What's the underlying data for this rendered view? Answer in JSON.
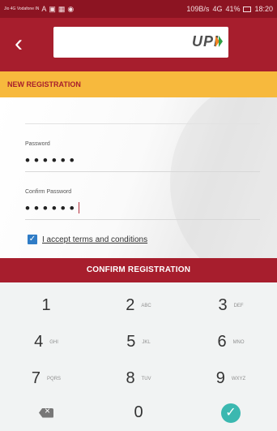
{
  "status_bar": {
    "carrier": "Jio 4G\nVodafone IN",
    "left_icons": [
      "A",
      "▣",
      "▦",
      "◉"
    ],
    "network_speed": "109B/s",
    "signal_text": "4G",
    "battery": "41%",
    "time": "18:20"
  },
  "app_bar": {
    "back_icon": "‹",
    "logo_text": "UPI"
  },
  "section": {
    "title": "NEW REGISTRATION"
  },
  "form": {
    "password_label": "Password",
    "password_value": "••••••",
    "confirm_label": "Confirm Password",
    "confirm_value": "••••••"
  },
  "terms": {
    "check_icon": "✓",
    "text": "I accept terms and conditions"
  },
  "confirm_button": {
    "label": "CONFIRM REGISTRATION"
  },
  "keypad": {
    "keys": [
      {
        "num": "1",
        "letters": ""
      },
      {
        "num": "2",
        "letters": "ABC"
      },
      {
        "num": "3",
        "letters": "DEF"
      },
      {
        "num": "4",
        "letters": "GHI"
      },
      {
        "num": "5",
        "letters": "JKL"
      },
      {
        "num": "6",
        "letters": "MNO"
      },
      {
        "num": "7",
        "letters": "PQRS"
      },
      {
        "num": "8",
        "letters": "TUV"
      },
      {
        "num": "9",
        "letters": "WXYZ"
      },
      {
        "num": "",
        "letters": ""
      },
      {
        "num": "0",
        "letters": ""
      },
      {
        "num": "",
        "letters": ""
      }
    ],
    "backspace_icon": "backspace-icon",
    "done_icon": "✓"
  },
  "colors": {
    "status": "#8c1422",
    "primary": "#a71e2d",
    "accent": "#f7b93d",
    "checkbox": "#2f7cc6",
    "done": "#3bb8b0"
  }
}
